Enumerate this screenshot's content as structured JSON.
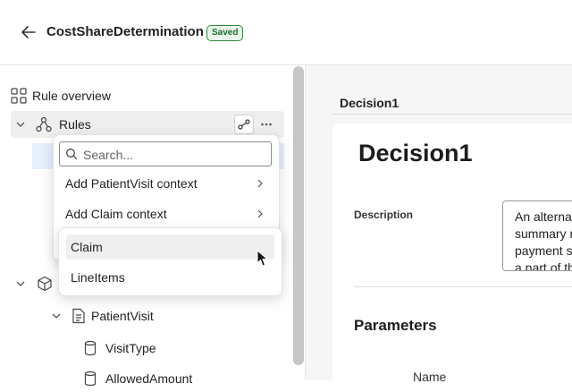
{
  "header": {
    "title": "CostShareDetermination",
    "badge": "Saved"
  },
  "sidebar": {
    "overview_label": "Rule overview",
    "rules_label": "Rules",
    "tree": [
      {
        "label": "PatientVisit"
      },
      {
        "label": "VisitType"
      },
      {
        "label": "AllowedAmount"
      }
    ]
  },
  "context_menu": {
    "search_placeholder": "Search...",
    "items": [
      {
        "label": "Add PatientVisit context"
      },
      {
        "label": "Add Claim context"
      }
    ],
    "submenu": [
      {
        "label": "Claim"
      },
      {
        "label": "LineItems"
      }
    ]
  },
  "main": {
    "breadcrumb": "Decision1",
    "title": "Decision1",
    "description_label": "Description",
    "description_lines": [
      "An alterna",
      "summary r",
      "payment s",
      "a part of th"
    ],
    "parameters_heading": "Parameters",
    "name_column": "Name"
  },
  "colors": {
    "badge_border": "#2f8a3c",
    "badge_bg": "#eaf6ea",
    "selection": "#e6effd",
    "hover": "#efefef"
  }
}
